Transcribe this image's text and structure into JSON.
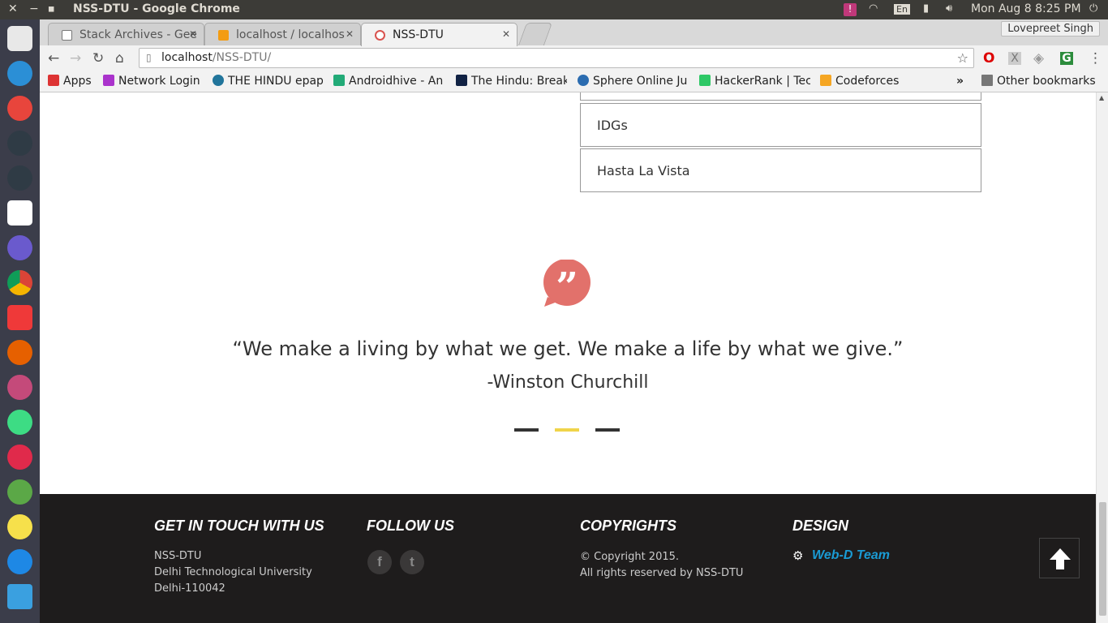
{
  "os": {
    "window_title": "NSS-DTU - Google Chrome",
    "clock": "Mon Aug  8  8:25 PM",
    "keyboard": "En"
  },
  "browser": {
    "tabs": [
      {
        "label": "Stack Archives - Gee",
        "favicon": "page-icon",
        "active": false
      },
      {
        "label": "localhost / localhos",
        "favicon": "phpmyadmin-icon",
        "active": false
      },
      {
        "label": "NSS-DTU",
        "favicon": "nss-icon",
        "active": true
      }
    ],
    "user": "Lovepreet Singh",
    "address": {
      "host": "localhost",
      "path": "/NSS-DTU/"
    },
    "bookmarks": [
      {
        "label": "Apps",
        "icon": "apps-grid-icon",
        "color": "#d33"
      },
      {
        "label": "Network Login",
        "icon": "umbrella-icon",
        "color": "#a3c"
      },
      {
        "label": "THE HINDU epap",
        "icon": "wordpress-icon",
        "color": "#21759b"
      },
      {
        "label": "Androidhive - An",
        "icon": "androidhive-icon",
        "color": "#2a7"
      },
      {
        "label": "The Hindu: Break",
        "icon": "th-icon",
        "color": "#124"
      },
      {
        "label": "Sphere Online Ju",
        "icon": "spoj-icon",
        "color": "#2b6cb0"
      },
      {
        "label": "HackerRank | Tec",
        "icon": "hackerrank-icon",
        "color": "#2ec866"
      },
      {
        "label": "Codeforces",
        "icon": "codeforces-icon",
        "color": "#f5a623"
      }
    ],
    "other_bookmarks": "Other bookmarks"
  },
  "page": {
    "list_items": [
      "IDGs",
      "Hasta La Vista"
    ],
    "quote": "“We make a living by what we get. We make a life by what we give.”",
    "quote_author": "-Winston Churchill",
    "slider_colors": [
      "#333333",
      "#f0d44a",
      "#333333"
    ],
    "accent": "#e2716b"
  },
  "footer": {
    "contact": {
      "heading": "GET IN TOUCH WITH US",
      "lines": [
        "NSS-DTU",
        "Delhi Technological University",
        "Delhi-110042"
      ]
    },
    "follow": {
      "heading": "FOLLOW US",
      "icons": [
        "facebook-icon",
        "twitter-icon"
      ]
    },
    "copyrights": {
      "heading": "COPYRIGHTS",
      "line1": "Copyright 2015.",
      "line2": "All rights reserved by NSS-DTU"
    },
    "design": {
      "heading": "DESIGN",
      "link": "Web-D Team"
    }
  }
}
